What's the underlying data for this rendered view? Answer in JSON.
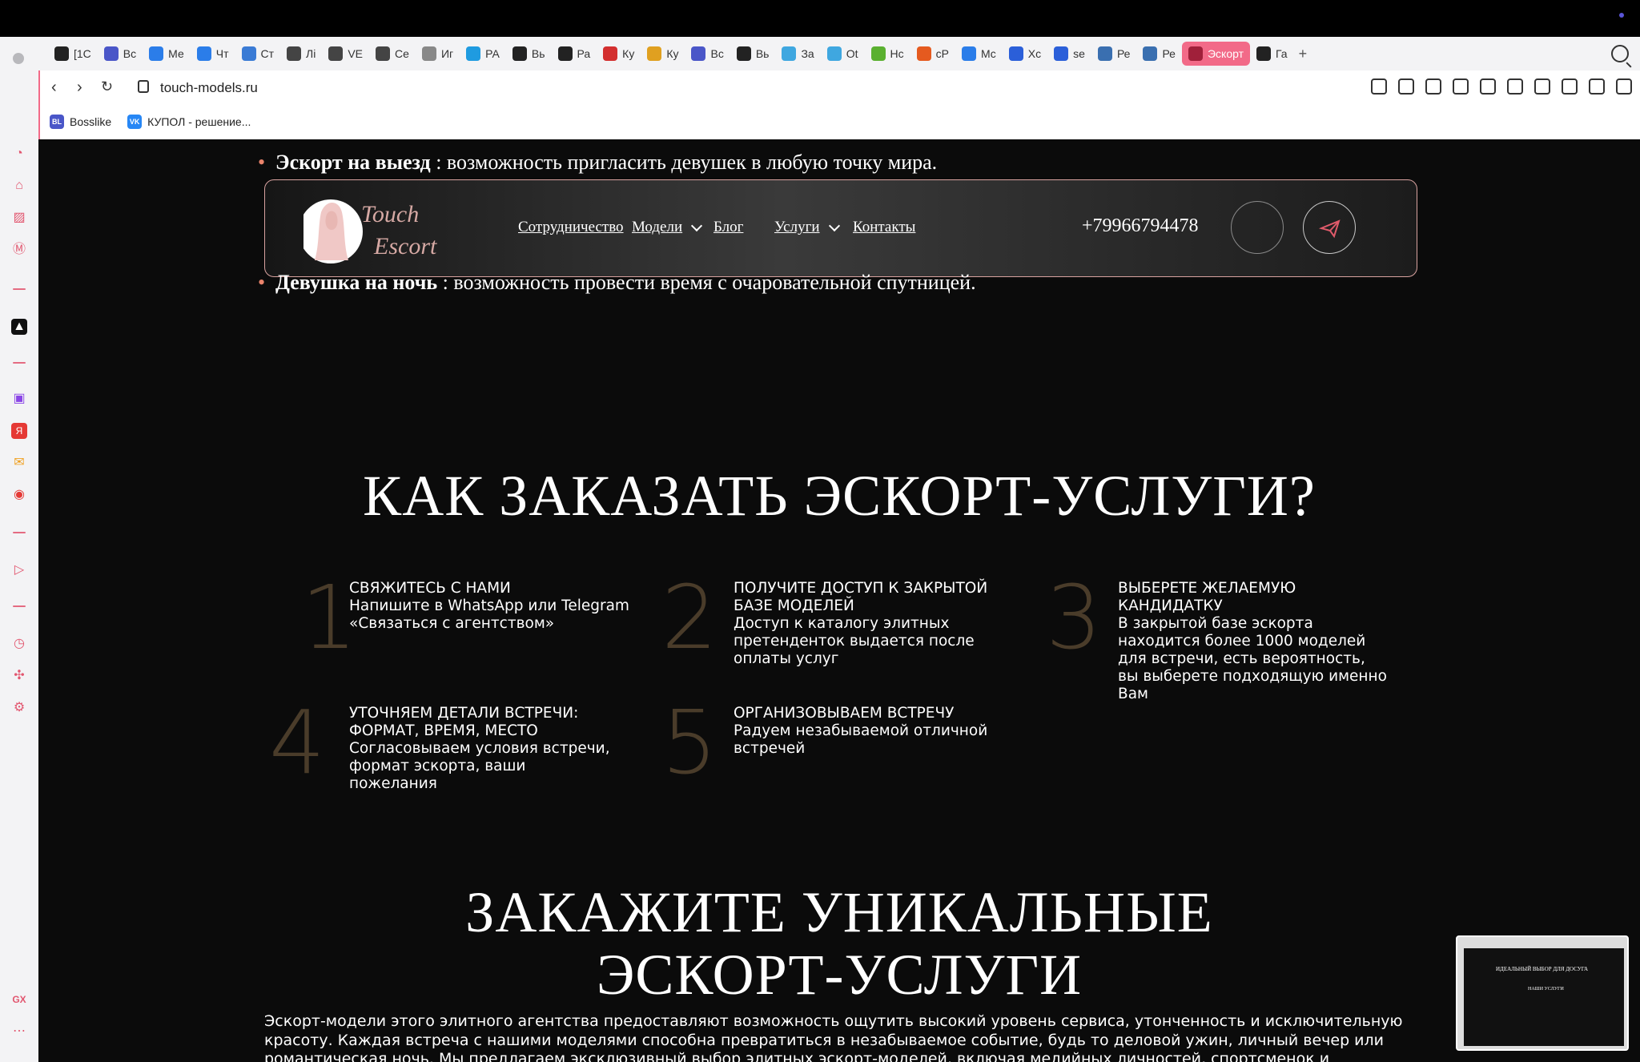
{
  "browser": {
    "url": "touch-models.ru",
    "tabs": [
      {
        "label": "[1С",
        "icon": "k-icon",
        "color": "#222"
      },
      {
        "label": "Вс",
        "icon": "bl-icon",
        "color": "#4a56c8"
      },
      {
        "label": "Ме",
        "icon": "chat-icon",
        "color": "#2b7de9"
      },
      {
        "label": "Чт",
        "icon": "at-icon",
        "color": "#2b7de9"
      },
      {
        "label": "Ст",
        "icon": "triangle-icon",
        "color": "#3a7bd5"
      },
      {
        "label": "Лі",
        "icon": "globe-icon",
        "color": "#444"
      },
      {
        "label": "VE",
        "icon": "spiral-icon",
        "color": "#444"
      },
      {
        "label": "Се",
        "icon": "spiral-icon",
        "color": "#444"
      },
      {
        "label": "Иг",
        "icon": "gear-icon",
        "color": "#888"
      },
      {
        "label": "РА",
        "icon": "p-icon",
        "color": "#1f9be0"
      },
      {
        "label": "Вь",
        "icon": "hood-icon",
        "color": "#222"
      },
      {
        "label": "Ра",
        "icon": "hood-icon",
        "color": "#222"
      },
      {
        "label": "Ку",
        "icon": "grid-icon",
        "color": "#d32f2f"
      },
      {
        "label": "Ку",
        "icon": "chrome-icon",
        "color": "#e0a020"
      },
      {
        "label": "Вс",
        "icon": "bl-icon",
        "color": "#4a56c8"
      },
      {
        "label": "Вь",
        "icon": "bc-icon",
        "color": "#222"
      },
      {
        "label": "За",
        "icon": "cloud-icon",
        "color": "#3fa7e0"
      },
      {
        "label": "Ot",
        "icon": "cloud-icon",
        "color": "#3fa7e0"
      },
      {
        "label": "Нс",
        "icon": "s-icon",
        "color": "#5ab030"
      },
      {
        "label": "сР",
        "icon": "cp-icon",
        "color": "#e55a1f"
      },
      {
        "label": "Мс",
        "icon": "chart-icon",
        "color": "#2b7de9"
      },
      {
        "label": "Хс",
        "icon": "folder-icon",
        "color": "#2b5fd9"
      },
      {
        "label": "se",
        "icon": "slash-icon",
        "color": "#2b5fd9"
      },
      {
        "label": "Ре",
        "icon": "wp-icon",
        "color": "#3a6fb0"
      },
      {
        "label": "Ре",
        "icon": "wp-icon",
        "color": "#3a6fb0"
      },
      {
        "label": "Эскорт",
        "icon": "escort-icon",
        "color": "#a0203a",
        "active": true
      },
      {
        "label": "Га",
        "icon": "r-icon",
        "color": "#222"
      }
    ],
    "bookmarks": [
      {
        "label": "Bosslike",
        "icon": "BL",
        "color": "#4a56c8"
      },
      {
        "label": "КУПОЛ - решение...",
        "icon": "VK",
        "color": "#2787f5"
      }
    ]
  },
  "page": {
    "bullets": [
      {
        "bold": "Эскорт на выезд",
        "text": " : возможность пригласить девушек в любую точку мира."
      },
      {
        "bold": "Девушка на ночь",
        "text": " : возможность провести время с очаровательной спутницей."
      }
    ],
    "nav": {
      "logo_line1": "Touch",
      "logo_line2": "Escort",
      "links": [
        "Сотрудничество",
        "Модели",
        "Блог",
        "Услуги",
        "Контакты"
      ],
      "phone": "+79966794478"
    },
    "how_title": "КАК ЗАКАЗАТЬ ЭСКОРТ-УСЛУГИ?",
    "steps": [
      {
        "num": "1",
        "title": "СВЯЖИТЕСЬ С НАМИ",
        "text": "Напишите в WhatsApp или Telegram «Связаться с агентством»"
      },
      {
        "num": "2",
        "title": "ПОЛУЧИТЕ ДОСТУП К ЗАКРЫТОЙ БАЗЕ МОДЕЛЕЙ",
        "text": "Доступ к каталогу элитных претенденток выдается после оплаты услуг"
      },
      {
        "num": "3",
        "title": "ВЫБЕРЕТЕ ЖЕЛАЕМУЮ КАНДИДАТКУ",
        "text": "В закрытой базе эскорта находится более 1000 моделей для встречи, есть вероятность, вы выберете подходящую именно Вам"
      },
      {
        "num": "4",
        "title": "УТОЧНЯЕМ ДЕТАЛИ ВСТРЕЧИ: ФОРМАТ, ВРЕМЯ, МЕСТО",
        "text": "Согласовываем условия встречи, формат эскорта, ваши пожелания"
      },
      {
        "num": "5",
        "title": "ОРГАНИЗОВЫВАЕМ ВСТРЕЧУ",
        "text": "Радуем незабываемой отличной встречей"
      }
    ],
    "order_title": "ЗАКАЖИТЕ УНИКАЛЬНЫЕ ЭСКОРТ-УСЛУГИ",
    "paragraph": "Эскорт-модели этого элитного агентства предоставляют возможность ощутить высокий уровень сервиса, утонченность и исключительную красоту. Каждая встреча с нашими моделями способна превратиться в незабываемое событие, будь то деловой ужин, личный вечер или романтическая ночь. Мы предлагаем эксклюзивный выбор элитных эскорт-моделей, включая медийных личностей, спортсменок и",
    "thumb": {
      "title": "ИДЕАЛЬНЫЙ ВЫБОР ДЛЯ ДОСУГА",
      "subtitle": "НАШИ УСЛУГИ"
    }
  }
}
